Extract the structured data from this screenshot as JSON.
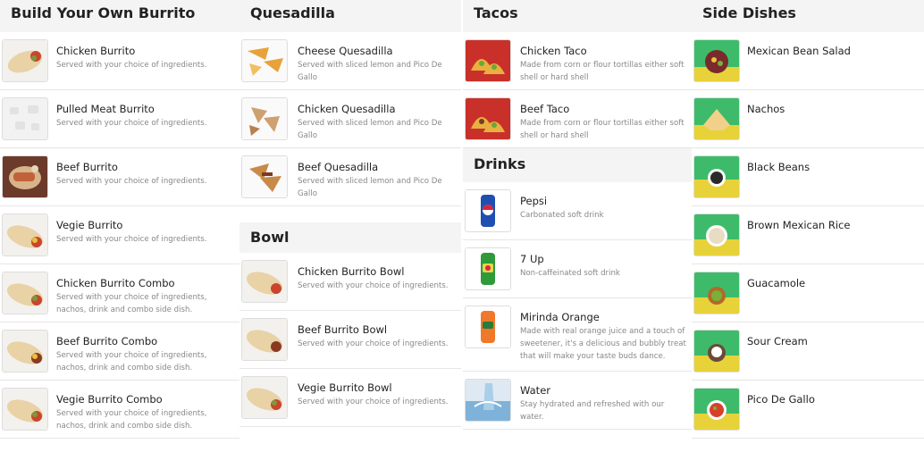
{
  "columns": [
    {
      "title": "Build Your Own Burrito",
      "items": [
        {
          "name": "Chicken Burrito",
          "desc": "Served with your choice of ingredients.",
          "icon": "burrito-photo"
        },
        {
          "name": "Pulled Meat Burrito",
          "desc": "Served with your choice of ingredients.",
          "icon": "placeholder-photo"
        },
        {
          "name": "Beef Burrito",
          "desc": "Served with your choice of ingredients.",
          "icon": "burrito-plate-photo"
        },
        {
          "name": "Vegie Burrito",
          "desc": "Served with your choice of ingredients.",
          "icon": "burrito-photo"
        },
        {
          "name": "Chicken Burrito Combo",
          "desc": "Served with your choice of ingredients, nachos, drink and combo side dish.",
          "icon": "burrito-photo"
        },
        {
          "name": "Beef Burrito Combo",
          "desc": "Served with your choice of ingredients, nachos, drink and combo side dish.",
          "icon": "burrito-photo"
        },
        {
          "name": "Vegie Burrito Combo",
          "desc": "Served with your choice of ingredients, nachos, drink and combo side dish.",
          "icon": "burrito-photo"
        }
      ]
    },
    {
      "title": "Quesadilla",
      "items": [
        {
          "name": "Cheese Quesadilla",
          "desc": "Served with sliced lemon and Pico De Gallo",
          "icon": "quesadilla-photo"
        },
        {
          "name": "Chicken Quesadilla",
          "desc": "Served with sliced lemon and Pico De Gallo",
          "icon": "quesadilla-photo"
        },
        {
          "name": "Beef Quesadilla",
          "desc": "Served with sliced lemon and Pico De Gallo",
          "icon": "quesadilla-photo"
        }
      ],
      "sub_title": "Bowl",
      "sub_items": [
        {
          "name": "Chicken Burrito Bowl",
          "desc": "Served with your choice of ingredients.",
          "icon": "burrito-photo"
        },
        {
          "name": "Beef Burrito Bowl",
          "desc": "Served with your choice of ingredients.",
          "icon": "burrito-photo"
        },
        {
          "name": "Vegie Burrito Bowl",
          "desc": "Served with your choice of ingredients.",
          "icon": "burrito-photo"
        }
      ]
    },
    {
      "title": "Tacos",
      "items": [
        {
          "name": "Chicken Taco",
          "desc": "Made from corn or flour tortillas either soft shell or hard shell",
          "icon": "taco-photo"
        },
        {
          "name": "Beef Taco",
          "desc": "Made from corn or flour tortillas either soft shell or hard shell",
          "icon": "taco-photo"
        }
      ],
      "sub_title": "Drinks",
      "sub_items": [
        {
          "name": "Pepsi",
          "desc": "Carbonated soft drink",
          "icon": "pepsi-can-photo"
        },
        {
          "name": "7 Up",
          "desc": "Non-caffeinated soft drink",
          "icon": "7up-can-photo"
        },
        {
          "name": "Mirinda Orange",
          "desc": "Made with real orange juice and a touch of sweetener, it's a delicious and bubbly treat that will make your taste buds dance.",
          "icon": "mirinda-can-photo"
        },
        {
          "name": "Water",
          "desc": "Stay hydrated and refreshed with our water.",
          "icon": "water-photo"
        }
      ]
    },
    {
      "title": "Side Dishes",
      "items": [
        {
          "name": "Mexican Bean Salad",
          "desc": "",
          "icon": "side-dish-photo"
        },
        {
          "name": "Nachos",
          "desc": "",
          "icon": "side-dish-photo"
        },
        {
          "name": "Black Beans",
          "desc": "",
          "icon": "side-dish-photo"
        },
        {
          "name": "Brown Mexican Rice",
          "desc": "",
          "icon": "side-dish-photo"
        },
        {
          "name": "Guacamole",
          "desc": "",
          "icon": "side-dish-photo"
        },
        {
          "name": "Sour Cream",
          "desc": "",
          "icon": "side-dish-photo"
        },
        {
          "name": "Pico De Gallo",
          "desc": "",
          "icon": "side-dish-photo"
        }
      ]
    }
  ]
}
